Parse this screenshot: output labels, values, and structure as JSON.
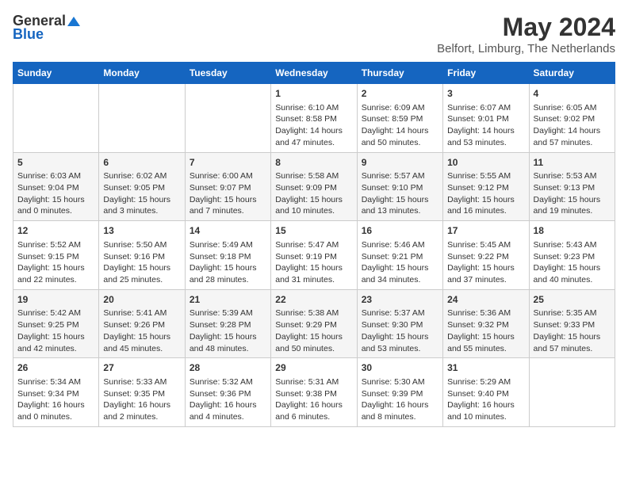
{
  "header": {
    "logo_general": "General",
    "logo_blue": "Blue",
    "title": "May 2024",
    "subtitle": "Belfort, Limburg, The Netherlands"
  },
  "weekdays": [
    "Sunday",
    "Monday",
    "Tuesday",
    "Wednesday",
    "Thursday",
    "Friday",
    "Saturday"
  ],
  "weeks": [
    [
      {
        "day": "",
        "sunrise": "",
        "sunset": "",
        "daylight": ""
      },
      {
        "day": "",
        "sunrise": "",
        "sunset": "",
        "daylight": ""
      },
      {
        "day": "",
        "sunrise": "",
        "sunset": "",
        "daylight": ""
      },
      {
        "day": "1",
        "sunrise": "Sunrise: 6:10 AM",
        "sunset": "Sunset: 8:58 PM",
        "daylight": "Daylight: 14 hours and 47 minutes."
      },
      {
        "day": "2",
        "sunrise": "Sunrise: 6:09 AM",
        "sunset": "Sunset: 8:59 PM",
        "daylight": "Daylight: 14 hours and 50 minutes."
      },
      {
        "day": "3",
        "sunrise": "Sunrise: 6:07 AM",
        "sunset": "Sunset: 9:01 PM",
        "daylight": "Daylight: 14 hours and 53 minutes."
      },
      {
        "day": "4",
        "sunrise": "Sunrise: 6:05 AM",
        "sunset": "Sunset: 9:02 PM",
        "daylight": "Daylight: 14 hours and 57 minutes."
      }
    ],
    [
      {
        "day": "5",
        "sunrise": "Sunrise: 6:03 AM",
        "sunset": "Sunset: 9:04 PM",
        "daylight": "Daylight: 15 hours and 0 minutes."
      },
      {
        "day": "6",
        "sunrise": "Sunrise: 6:02 AM",
        "sunset": "Sunset: 9:05 PM",
        "daylight": "Daylight: 15 hours and 3 minutes."
      },
      {
        "day": "7",
        "sunrise": "Sunrise: 6:00 AM",
        "sunset": "Sunset: 9:07 PM",
        "daylight": "Daylight: 15 hours and 7 minutes."
      },
      {
        "day": "8",
        "sunrise": "Sunrise: 5:58 AM",
        "sunset": "Sunset: 9:09 PM",
        "daylight": "Daylight: 15 hours and 10 minutes."
      },
      {
        "day": "9",
        "sunrise": "Sunrise: 5:57 AM",
        "sunset": "Sunset: 9:10 PM",
        "daylight": "Daylight: 15 hours and 13 minutes."
      },
      {
        "day": "10",
        "sunrise": "Sunrise: 5:55 AM",
        "sunset": "Sunset: 9:12 PM",
        "daylight": "Daylight: 15 hours and 16 minutes."
      },
      {
        "day": "11",
        "sunrise": "Sunrise: 5:53 AM",
        "sunset": "Sunset: 9:13 PM",
        "daylight": "Daylight: 15 hours and 19 minutes."
      }
    ],
    [
      {
        "day": "12",
        "sunrise": "Sunrise: 5:52 AM",
        "sunset": "Sunset: 9:15 PM",
        "daylight": "Daylight: 15 hours and 22 minutes."
      },
      {
        "day": "13",
        "sunrise": "Sunrise: 5:50 AM",
        "sunset": "Sunset: 9:16 PM",
        "daylight": "Daylight: 15 hours and 25 minutes."
      },
      {
        "day": "14",
        "sunrise": "Sunrise: 5:49 AM",
        "sunset": "Sunset: 9:18 PM",
        "daylight": "Daylight: 15 hours and 28 minutes."
      },
      {
        "day": "15",
        "sunrise": "Sunrise: 5:47 AM",
        "sunset": "Sunset: 9:19 PM",
        "daylight": "Daylight: 15 hours and 31 minutes."
      },
      {
        "day": "16",
        "sunrise": "Sunrise: 5:46 AM",
        "sunset": "Sunset: 9:21 PM",
        "daylight": "Daylight: 15 hours and 34 minutes."
      },
      {
        "day": "17",
        "sunrise": "Sunrise: 5:45 AM",
        "sunset": "Sunset: 9:22 PM",
        "daylight": "Daylight: 15 hours and 37 minutes."
      },
      {
        "day": "18",
        "sunrise": "Sunrise: 5:43 AM",
        "sunset": "Sunset: 9:23 PM",
        "daylight": "Daylight: 15 hours and 40 minutes."
      }
    ],
    [
      {
        "day": "19",
        "sunrise": "Sunrise: 5:42 AM",
        "sunset": "Sunset: 9:25 PM",
        "daylight": "Daylight: 15 hours and 42 minutes."
      },
      {
        "day": "20",
        "sunrise": "Sunrise: 5:41 AM",
        "sunset": "Sunset: 9:26 PM",
        "daylight": "Daylight: 15 hours and 45 minutes."
      },
      {
        "day": "21",
        "sunrise": "Sunrise: 5:39 AM",
        "sunset": "Sunset: 9:28 PM",
        "daylight": "Daylight: 15 hours and 48 minutes."
      },
      {
        "day": "22",
        "sunrise": "Sunrise: 5:38 AM",
        "sunset": "Sunset: 9:29 PM",
        "daylight": "Daylight: 15 hours and 50 minutes."
      },
      {
        "day": "23",
        "sunrise": "Sunrise: 5:37 AM",
        "sunset": "Sunset: 9:30 PM",
        "daylight": "Daylight: 15 hours and 53 minutes."
      },
      {
        "day": "24",
        "sunrise": "Sunrise: 5:36 AM",
        "sunset": "Sunset: 9:32 PM",
        "daylight": "Daylight: 15 hours and 55 minutes."
      },
      {
        "day": "25",
        "sunrise": "Sunrise: 5:35 AM",
        "sunset": "Sunset: 9:33 PM",
        "daylight": "Daylight: 15 hours and 57 minutes."
      }
    ],
    [
      {
        "day": "26",
        "sunrise": "Sunrise: 5:34 AM",
        "sunset": "Sunset: 9:34 PM",
        "daylight": "Daylight: 16 hours and 0 minutes."
      },
      {
        "day": "27",
        "sunrise": "Sunrise: 5:33 AM",
        "sunset": "Sunset: 9:35 PM",
        "daylight": "Daylight: 16 hours and 2 minutes."
      },
      {
        "day": "28",
        "sunrise": "Sunrise: 5:32 AM",
        "sunset": "Sunset: 9:36 PM",
        "daylight": "Daylight: 16 hours and 4 minutes."
      },
      {
        "day": "29",
        "sunrise": "Sunrise: 5:31 AM",
        "sunset": "Sunset: 9:38 PM",
        "daylight": "Daylight: 16 hours and 6 minutes."
      },
      {
        "day": "30",
        "sunrise": "Sunrise: 5:30 AM",
        "sunset": "Sunset: 9:39 PM",
        "daylight": "Daylight: 16 hours and 8 minutes."
      },
      {
        "day": "31",
        "sunrise": "Sunrise: 5:29 AM",
        "sunset": "Sunset: 9:40 PM",
        "daylight": "Daylight: 16 hours and 10 minutes."
      },
      {
        "day": "",
        "sunrise": "",
        "sunset": "",
        "daylight": ""
      }
    ]
  ]
}
